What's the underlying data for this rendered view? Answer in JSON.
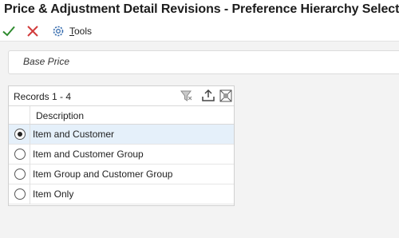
{
  "window": {
    "title": "Price & Adjustment Detail Revisions - Preference Hierarchy Selection"
  },
  "toolbar": {
    "ok_icon": "checkmark-icon",
    "cancel_icon": "close-icon",
    "tools_icon": "gear-icon",
    "tools_label": "Tools",
    "ok_color": "#2e8b2e",
    "cancel_color": "#d23b3b"
  },
  "base_price": {
    "label": "Base Price"
  },
  "grid": {
    "records_label": "Records 1 - 4",
    "icons": [
      "filter-icon",
      "export-icon",
      "fullscreen-icon"
    ],
    "columns": [
      "Description"
    ],
    "rows": [
      {
        "description": "Item and Customer",
        "selected": true
      },
      {
        "description": "Item and Customer Group",
        "selected": false
      },
      {
        "description": "Item Group and Customer Group",
        "selected": false
      },
      {
        "description": "Item Only",
        "selected": false
      }
    ],
    "selected_row_color": "#e5f0fa"
  }
}
